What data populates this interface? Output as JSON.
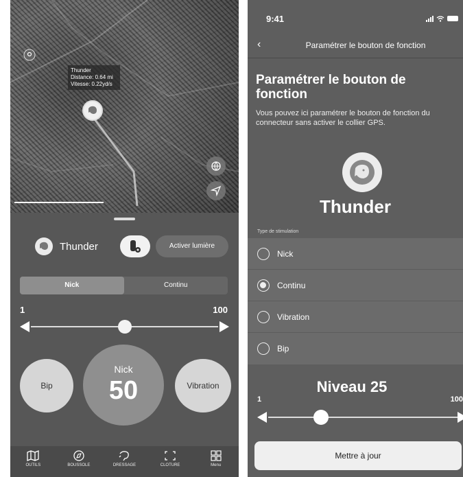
{
  "left_screen": {
    "map": {
      "popup": {
        "name": "Thunder",
        "distance": "Distance: 0.64 mi",
        "speed": "Vitesse: 0.22yd/s"
      }
    },
    "dog_name": "Thunder",
    "light_button": "Activer lumière",
    "segment": {
      "options": [
        "Nick",
        "Continu"
      ],
      "selected": "Nick"
    },
    "range": {
      "min": "1",
      "max": "100",
      "value_fraction": 0.5
    },
    "circles": {
      "left": "Bip",
      "center_label": "Nick",
      "center_value": "50",
      "right": "Vibration"
    },
    "tabs": [
      {
        "icon": "map-icon",
        "label": "OUTILS"
      },
      {
        "icon": "compass-icon",
        "label": "BOUSSOLE"
      },
      {
        "icon": "dog-training-icon",
        "label": "DRESSAGE"
      },
      {
        "icon": "fence-icon",
        "label": "CLOTURE"
      },
      {
        "icon": "grid-menu-icon",
        "label": "Menu"
      }
    ]
  },
  "right_screen": {
    "status_time": "9:41",
    "nav_title": "Paramétrer le bouton de fonction",
    "title": "Paramétrer le bouton de fonction",
    "description": "Vous pouvez ici paramétrer le bouton de fonction du connecteur sans activer le collier GPS.",
    "dog_name": "Thunder",
    "stimulation_label": "Type de stimulation",
    "options": [
      {
        "label": "Nick",
        "checked": false
      },
      {
        "label": "Continu",
        "checked": true
      },
      {
        "label": "Vibration",
        "checked": false
      },
      {
        "label": "Bip",
        "checked": false
      }
    ],
    "level": "Niveau 25",
    "range": {
      "min": "1",
      "max": "100",
      "value_fraction": 0.25
    },
    "update_button": "Mettre à jour"
  }
}
